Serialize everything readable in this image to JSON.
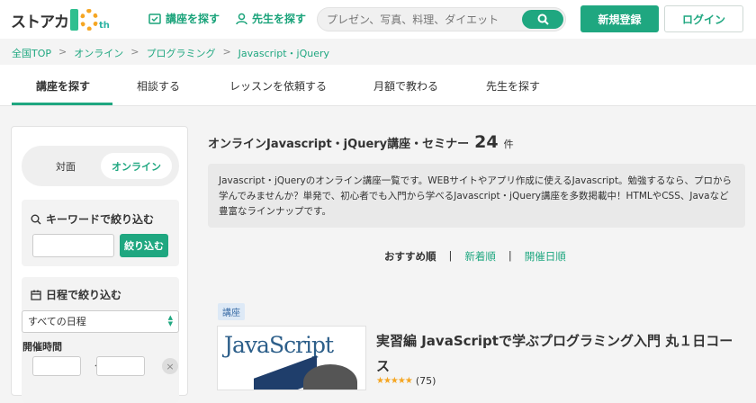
{
  "header": {
    "logo_text": "ストアカ",
    "logo_badge": "th",
    "nav_courses": "講座を探す",
    "nav_teachers": "先生を探す",
    "search_placeholder": "プレゼン、写真、料理、ダイエット",
    "register": "新規登録",
    "login": "ログイン",
    "accent": "#1fa780"
  },
  "breadcrumb": [
    "全国TOP",
    "オンライン",
    "プログラミング",
    "Javascript・jQuery"
  ],
  "breadcrumb_sep": ">",
  "tabs": [
    "講座を探す",
    "相談する",
    "レッスンを依頼する",
    "月額で教わる",
    "先生を探す"
  ],
  "sidebar": {
    "toggle_offline": "対面",
    "toggle_online": "オンライン",
    "keyword_title": "キーワードで絞り込む",
    "keyword_button": "絞り込む",
    "date_title": "日程で絞り込む",
    "date_selected": "すべての日程",
    "time_label": "開催時間",
    "tilde": "〜",
    "clear": "×"
  },
  "main": {
    "title": "オンラインJavascript・jQuery講座・セミナー",
    "count": "24",
    "count_unit": "件",
    "description": "Javascript・jQueryのオンライン講座一覧です。WEBサイトやアプリ作成に使えるJavascript。勉強するなら、プロから学んでみませんか？単発で、初心者でも入門から学べるJavascript・jQuery講座を多数掲載中！HTMLやCSS、Javaなど豊富なラインナップです。",
    "sort": [
      "おすすめ順",
      "新着順",
      "開催日順"
    ],
    "sort_sep": "|"
  },
  "course": {
    "badge": "講座",
    "thumb_text": "JavaScript",
    "title": "実習編 JavaScriptで学ぶプログラミング入門 丸１日コース",
    "rating_count": "(75)",
    "rating_value": 5
  }
}
